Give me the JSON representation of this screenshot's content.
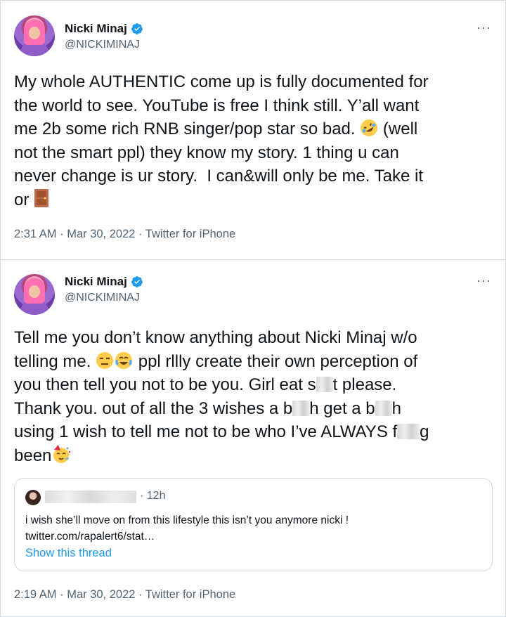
{
  "tweets": [
    {
      "author": {
        "name": "Nicki Minaj",
        "handle": "@NICKIMINAJ",
        "verified": true
      },
      "more_label": "···",
      "text_segments": [
        "My whole AUTHENTIC come up is fully documented for",
        "the world to see. YouTube is free I think still. Y’all want",
        "me 2b some rich RNB singer/pop star so bad.",
        " (well",
        "not the smart ppl) they know my story. 1 thing u can",
        "never change is ur story.  I can&will only be me. Take it",
        "or"
      ],
      "emojis": [
        "rolling-on-floor-laughing-emoji",
        "door-emoji"
      ],
      "timestamp": "2:31 AM · Mar 30, 2022 · Twitter for iPhone"
    },
    {
      "author": {
        "name": "Nicki Minaj",
        "handle": "@NICKIMINAJ",
        "verified": true
      },
      "more_label": "···",
      "text_segments": [
        "Tell me you don’t know anything about Nicki Minaj w/o",
        "telling me.",
        "ppl rllly create their own perception of",
        "you then tell you not to be you. Girl eat s",
        "t please.",
        "Thank you. out of all the 3 wishes a b",
        "h get a b",
        "h",
        "using 1 wish to tell me not to be who I’ve ALWAYS f",
        "g",
        "been"
      ],
      "emojis": [
        "expressionless-face-emoji",
        "tears-of-joy-emoji",
        "partying-face-emoji"
      ],
      "quote": {
        "time": "· 12h",
        "text": "i wish she’ll move on from this lifestyle this isn’t you anymore nicki !",
        "link_text": "twitter.com/rapalert6/stat…",
        "show_thread": "Show this thread"
      },
      "timestamp": "2:19 AM · Mar 30, 2022 · Twitter for iPhone"
    }
  ],
  "colors": {
    "text": "#0f1419",
    "secondary": "#536471",
    "border": "#cfd9de",
    "link": "#1d9bf0",
    "verified": "#1d9bf0"
  }
}
